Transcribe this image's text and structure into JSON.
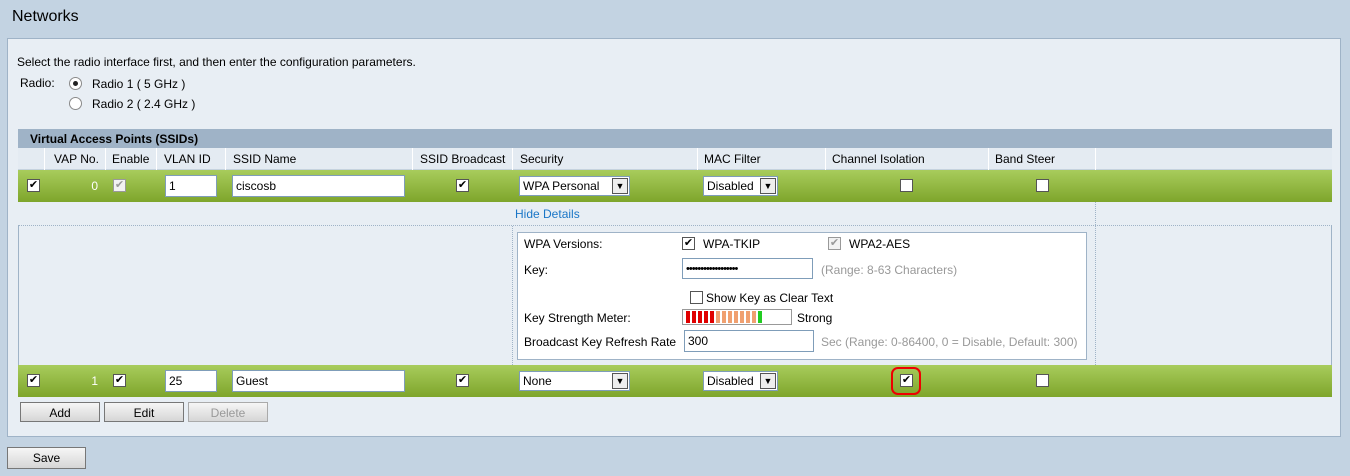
{
  "page_title": "Networks",
  "instruction": "Select the radio interface first, and then enter the configuration parameters.",
  "radio": {
    "label": "Radio:",
    "options": [
      "Radio 1  ( 5 GHz )",
      "Radio 2  ( 2.4 GHz )"
    ],
    "selected": 0
  },
  "table": {
    "title": "Virtual Access Points (SSIDs)",
    "columns": [
      "VAP No.",
      "Enable",
      "VLAN ID",
      "SSID Name",
      "SSID Broadcast",
      "Security",
      "MAC Filter",
      "Channel Isolation",
      "Band Steer"
    ],
    "rows": [
      {
        "vap_no": "0",
        "vlan_id": "1",
        "ssid_name": "ciscosb",
        "security": "WPA Personal",
        "mac_filter": "Disabled"
      },
      {
        "vap_no": "1",
        "vlan_id": "25",
        "ssid_name": "Guest",
        "security": "None",
        "mac_filter": "Disabled"
      }
    ],
    "hide_details": "Hide Details"
  },
  "details": {
    "wpa_versions_label": "WPA Versions:",
    "wpa_tkip": "WPA-TKIP",
    "wpa2_aes": "WPA2-AES",
    "key_label": "Key:",
    "key_value": "••••••••••••••••••",
    "key_hint": "(Range: 8-63 Characters)",
    "show_key": "Show Key as Clear Text",
    "strength_label": "Key Strength Meter:",
    "strength_value": "Strong",
    "refresh_label": "Broadcast Key Refresh Rate",
    "refresh_value": "300",
    "refresh_hint": "Sec (Range: 0-86400, 0 = Disable, Default: 300)"
  },
  "buttons": {
    "add": "Add",
    "edit": "Edit",
    "delete": "Delete",
    "save": "Save"
  },
  "colors": {
    "row_green": "#8fb83f",
    "highlight": "#e00000",
    "link": "#1a76c7"
  }
}
